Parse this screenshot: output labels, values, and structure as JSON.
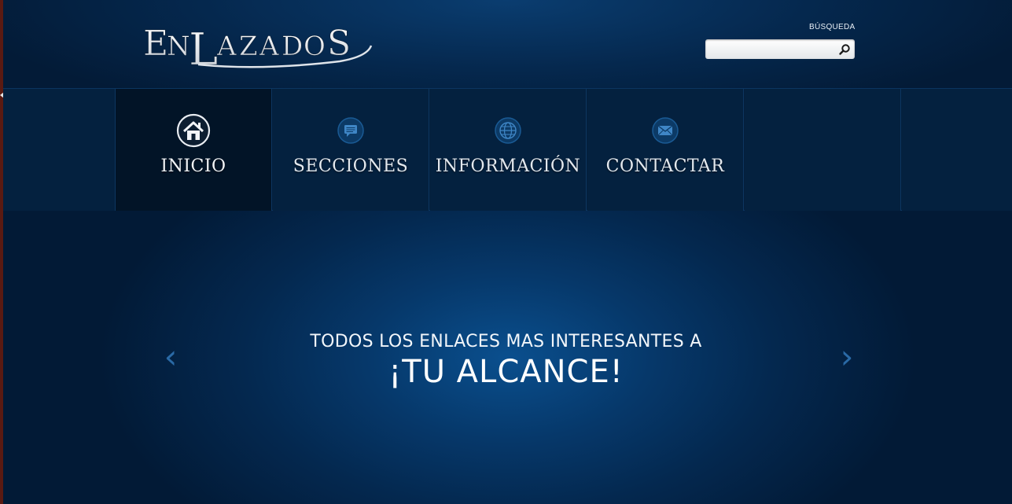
{
  "header": {
    "logo_text": "ENLAZADOS",
    "search": {
      "label": "BÚSQUEDA",
      "placeholder": "",
      "value": ""
    }
  },
  "nav": {
    "items": [
      {
        "label": "INICIO",
        "icon": "home-icon",
        "active": true
      },
      {
        "label": "SECCIONES",
        "icon": "chat-bubble-icon",
        "active": false
      },
      {
        "label": "INFORMACIÓN",
        "icon": "globe-icon",
        "active": false
      },
      {
        "label": "CONTACTAR",
        "icon": "envelope-icon",
        "active": false
      }
    ]
  },
  "slider": {
    "line1": "TODOS LOS ENLACES MAS INTERESANTES A",
    "line2": "¡TU ALCANCE!",
    "prev_arrow": "‹",
    "next_arrow": "›"
  },
  "colors": {
    "background": "#02152b",
    "accent": "#0a4f8e",
    "nav_active": "#021427",
    "arrow": "#2a6aa6"
  }
}
